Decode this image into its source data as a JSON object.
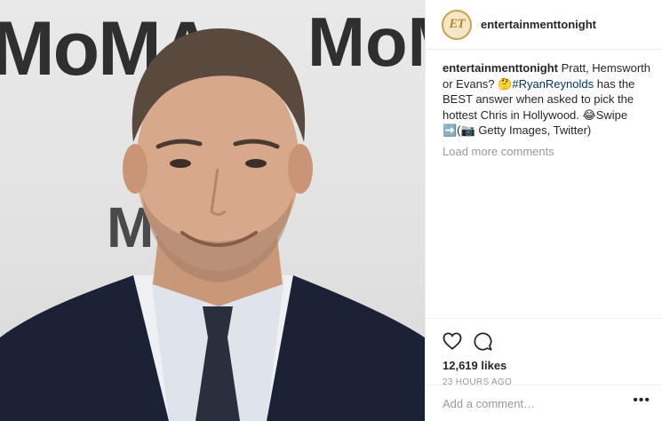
{
  "photo": {
    "backdrop_text_top": "MoMA",
    "backdrop_text_mid": "MoMA",
    "alt": ""
  },
  "header": {
    "avatar_initials": "ET",
    "username": "entertainmenttonight"
  },
  "caption": {
    "username": "entertainmenttonight",
    "text_1": " Pratt, Hemsworth or Evans? 🤔",
    "hashtag": "#RyanReynolds",
    "text_2": " has the BEST answer when asked to pick the hottest Chris in Hollywood. 😂Swipe ➡️(📷 Getty Images, Twitter)"
  },
  "load_more_label": "Load more comments",
  "actions": {
    "like_icon": "heart-icon",
    "comment_icon": "comment-icon"
  },
  "likes_text": "12,619 likes",
  "timestamp": "23 HOURS AGO",
  "add_comment": {
    "placeholder": "Add a comment…",
    "more_label": "•••"
  },
  "colors": {
    "hashtag": "#003569",
    "muted": "#999999",
    "text": "#262626",
    "avatar_ring": "#c8a24a"
  }
}
